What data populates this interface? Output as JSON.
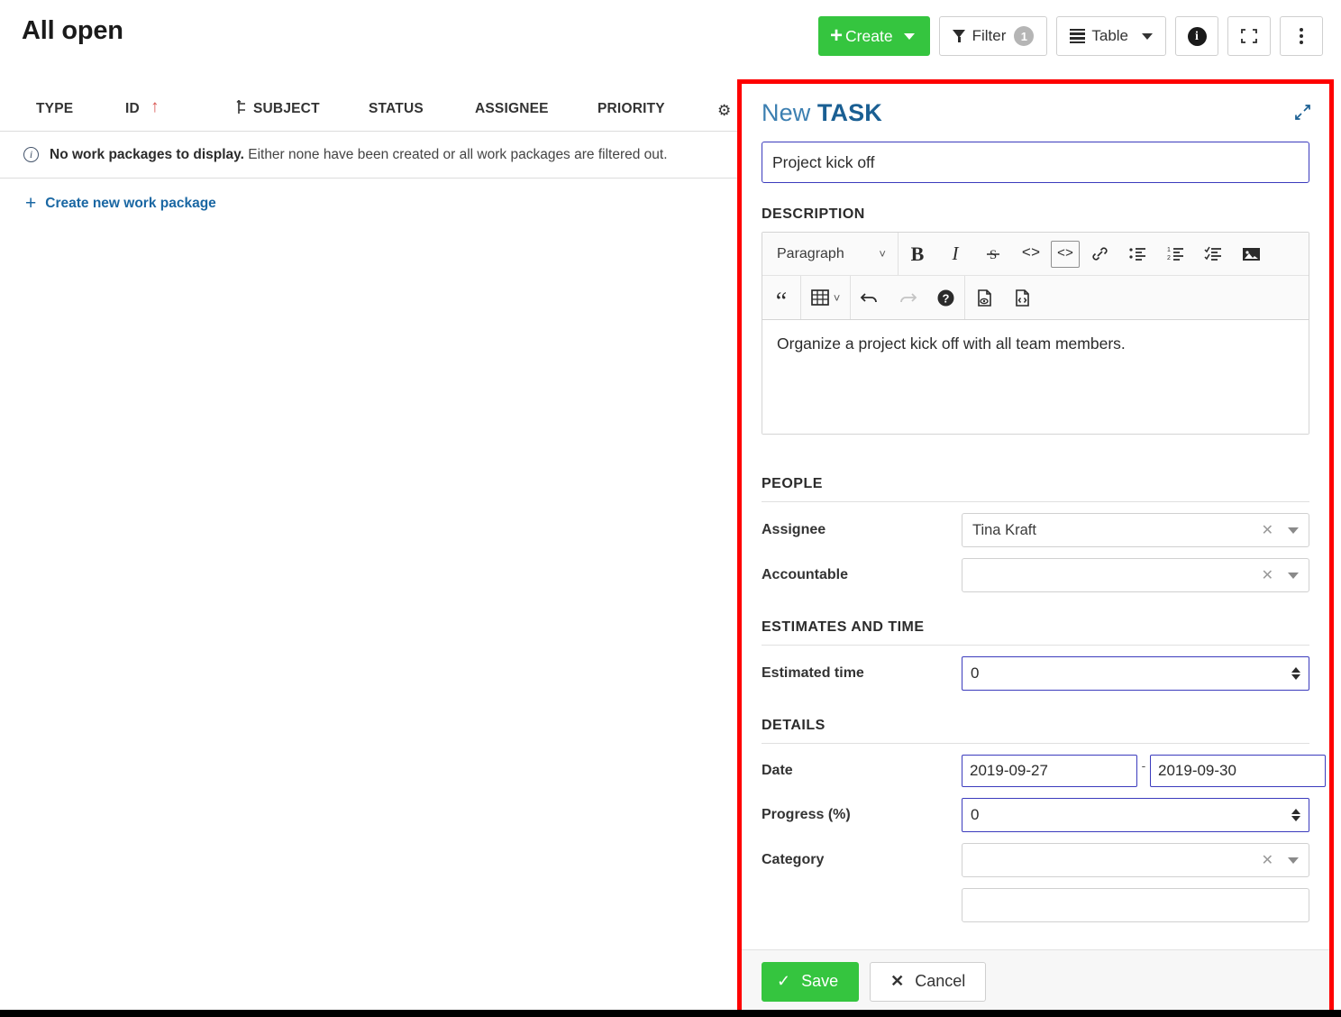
{
  "page": {
    "title": "All open"
  },
  "toolbar": {
    "create_label": "Create",
    "filter_label": "Filter",
    "filter_count": "1",
    "table_label": "Table",
    "info_icon": "info-icon",
    "fullscreen_icon": "fullscreen-icon",
    "more_icon": "kebab-menu-icon"
  },
  "table": {
    "columns": [
      "TYPE",
      "ID",
      "SUBJECT",
      "STATUS",
      "ASSIGNEE",
      "PRIORITY"
    ],
    "sort_indicator": "↑",
    "hierarchy_icon": "hierarchy-icon",
    "settings_icon": "gear-icon",
    "empty_strong": "No work packages to display.",
    "empty_rest": " Either none have been created or all work packages are filtered out.",
    "create_new_label": "Create new work package",
    "create_new_plus": "+"
  },
  "panel": {
    "title_prefix": "New ",
    "title_type": "TASK",
    "expand_icon": "expand-diagonal-icon",
    "subject_value": "Project kick off",
    "description": {
      "heading": "DESCRIPTION",
      "format_select": "Paragraph",
      "body_text": "Organize a project kick off with all team members.",
      "toolbar_row1": [
        {
          "name": "bold-icon",
          "glyph": "B"
        },
        {
          "name": "italic-icon",
          "glyph": "I"
        },
        {
          "name": "strikethrough-icon",
          "glyph": "S"
        },
        {
          "name": "inline-code-icon",
          "glyph": "<>"
        },
        {
          "name": "code-block-icon",
          "glyph": "<>"
        },
        {
          "name": "link-icon",
          "glyph": "link"
        },
        {
          "name": "bulleted-list-icon",
          "glyph": "ul"
        },
        {
          "name": "numbered-list-icon",
          "glyph": "ol"
        },
        {
          "name": "todo-list-icon",
          "glyph": "tl"
        },
        {
          "name": "insert-image-icon",
          "glyph": "img"
        }
      ],
      "toolbar_row2": [
        {
          "name": "block-quote-icon",
          "glyph": "“"
        },
        {
          "name": "insert-table-icon",
          "glyph": "table"
        },
        {
          "name": "undo-icon",
          "glyph": "↶"
        },
        {
          "name": "redo-icon",
          "glyph": "↷"
        },
        {
          "name": "help-icon",
          "glyph": "?"
        },
        {
          "name": "preview-document-icon",
          "glyph": "preview"
        },
        {
          "name": "markdown-source-icon",
          "glyph": "source"
        }
      ]
    },
    "people": {
      "heading": "PEOPLE",
      "assignee_label": "Assignee",
      "assignee_value": "Tina Kraft",
      "accountable_label": "Accountable",
      "accountable_value": ""
    },
    "estimates": {
      "heading": "ESTIMATES AND TIME",
      "estimated_time_label": "Estimated time",
      "estimated_time_value": "0"
    },
    "details": {
      "heading": "DETAILS",
      "date_label": "Date",
      "date_start": "2019-09-27",
      "date_separator": "-",
      "date_end": "2019-09-30",
      "progress_label": "Progress (%)",
      "progress_value": "0",
      "category_label": "Category",
      "category_value": ""
    },
    "footer": {
      "save_label": "Save",
      "save_check": "✓",
      "cancel_label": "Cancel",
      "cancel_x": "✕"
    }
  },
  "colors": {
    "accent_green": "#35c53f",
    "highlight_red": "#fe0000",
    "link_blue": "#1a67a3",
    "panel_title_blue": "#1a5f93",
    "field_focus_blue": "#3b3bbd"
  }
}
